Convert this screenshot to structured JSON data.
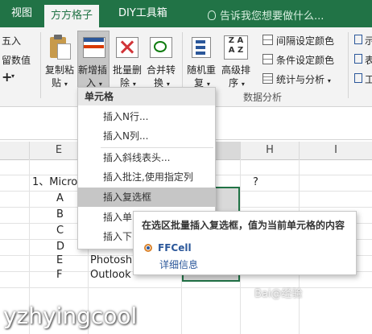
{
  "ribbon_tabs": [
    "视图",
    "方方格子",
    "DIY工具箱"
  ],
  "search": {
    "placeholder": "告诉我您想要做什么..."
  },
  "ribbon": {
    "round_label": "五入",
    "keep_value_label": "留数值",
    "plus_glyph": "+",
    "paste_label": [
      "复制粘",
      "贴"
    ],
    "insert_label": [
      "新增插",
      "入"
    ],
    "batch_delete_label": [
      "批量删",
      "除"
    ],
    "merge_convert_label": [
      "合并转",
      "换"
    ],
    "random_label": [
      "随机重",
      "复"
    ],
    "sort_label": [
      "高级排",
      "序"
    ],
    "alt_color_label": "间隔设定颜色",
    "cond_color_label": "条件设定颜色",
    "stats_label": "统计与分析",
    "group_data_analysis": "数据分析",
    "right_snips": [
      "示",
      "表",
      "工"
    ]
  },
  "columns": [
    "E",
    "H",
    "I"
  ],
  "sheet": {
    "question": "1、Micro",
    "question_mark": "?",
    "letters": [
      "A",
      "B",
      "C",
      "D",
      "E",
      "F"
    ],
    "answers_visible": {
      "e": "Photosh",
      "f": "Outlook"
    }
  },
  "menu": {
    "header": "单元格",
    "items": [
      "插入N行...",
      "插入N列...",
      "插入斜线表头...",
      "插入批注,使用指定列",
      "插入复选框",
      "插入单",
      "插入下"
    ],
    "selected_index": 4
  },
  "tooltip": {
    "text": "在选区批量插入复选框，值为当前单元格的内容",
    "app": "FFCell",
    "link": "详细信息"
  },
  "watermark": "yzhyingcool",
  "watermark_logo": "Bai@经验"
}
